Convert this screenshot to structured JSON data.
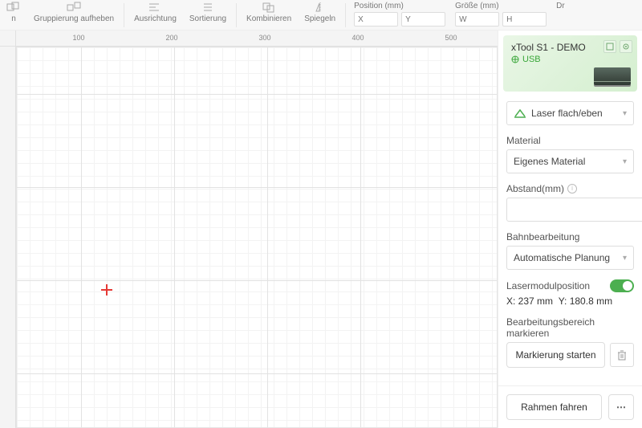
{
  "toolbar": {
    "group_label": "n",
    "ungroup_label": "Gruppierung aufheben",
    "align_label": "Ausrichtung",
    "sort_label": "Sortierung",
    "combine_label": "Kombinieren",
    "mirror_label": "Spiegeln",
    "position_label": "Position (mm)",
    "size_label": "Größe (mm)",
    "rotation_label": "Dr",
    "x_ph": "X",
    "y_ph": "Y",
    "w_ph": "W",
    "h_ph": "H"
  },
  "ruler": {
    "t100": "100",
    "t200": "200",
    "t300": "300",
    "t400": "400",
    "t500": "500"
  },
  "side": {
    "device_title": "xTool S1 - DEMO",
    "usb_label": "USB",
    "laser_mode": "Laser flach/eben",
    "material_label": "Material",
    "material_value": "Eigenes Material",
    "distance_label": "Abstand(mm)",
    "path_label": "Bahnbearbeitung",
    "path_value": "Automatische Planung",
    "modpos_label": "Lasermodulposition",
    "modpos_x": "X: 237 mm",
    "modpos_y": "Y: 180.8 mm",
    "markarea_label": "Bearbeitungsbereich markieren",
    "mark_start": "Markierung starten",
    "frame_btn": "Rahmen fahren"
  }
}
